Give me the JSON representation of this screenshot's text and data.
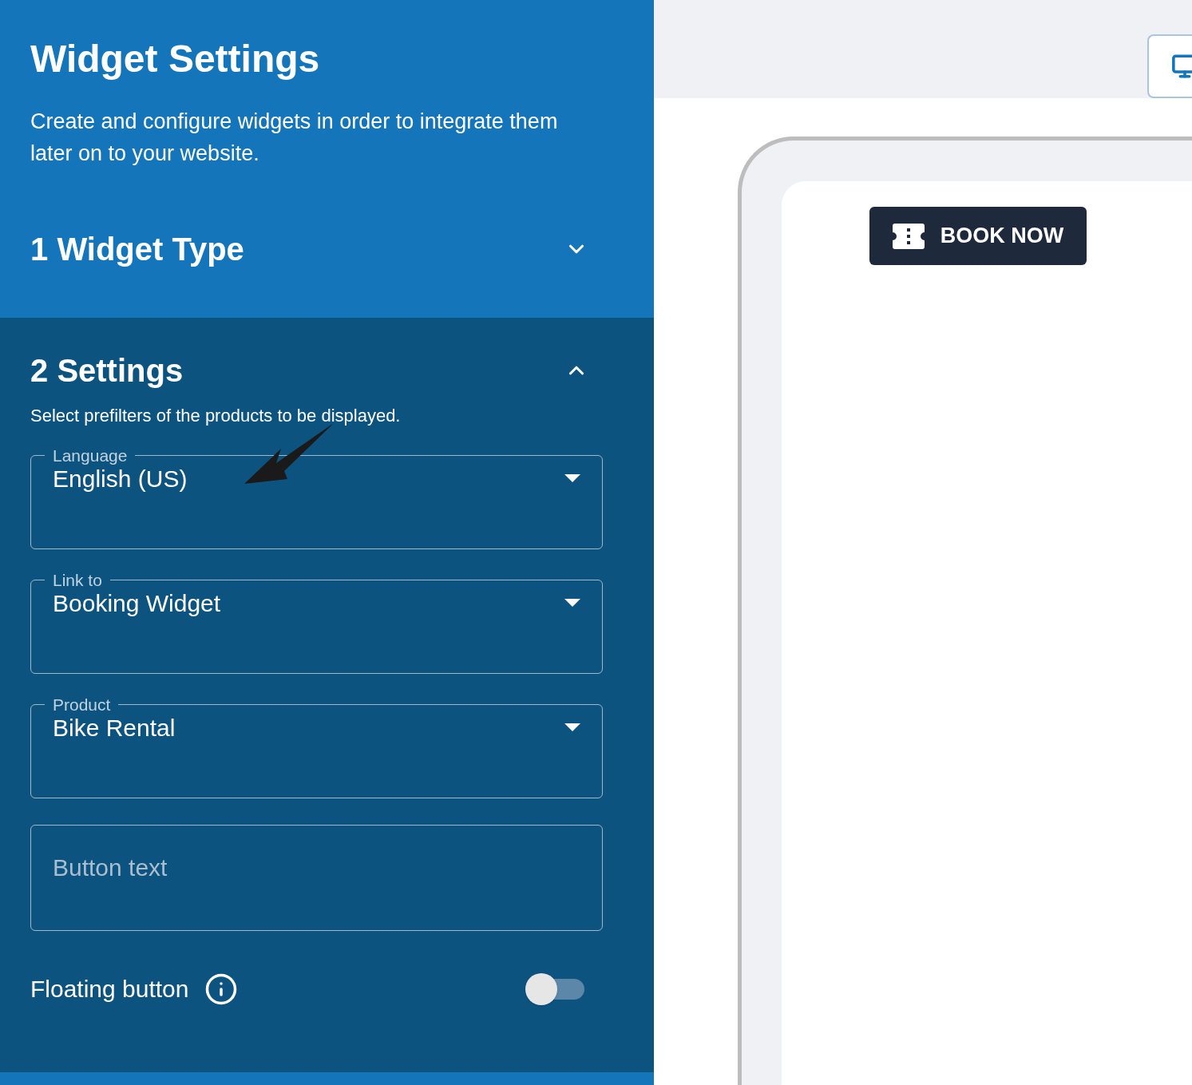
{
  "sidebar": {
    "title": "Widget Settings",
    "description": "Create and configure widgets in order to integrate them later on to your website.",
    "sections": [
      {
        "number": "1",
        "title": "Widget Type",
        "expanded": false
      },
      {
        "number": "2",
        "title": "Settings",
        "expanded": true,
        "description": "Select prefilters of the products to be displayed.",
        "fields": [
          {
            "kind": "select",
            "label": "Language",
            "value": "English (US)"
          },
          {
            "kind": "select",
            "label": "Link to",
            "value": "Booking Widget"
          },
          {
            "kind": "select",
            "label": "Product",
            "value": "Bike Rental"
          },
          {
            "kind": "text",
            "placeholder": "Button text"
          }
        ],
        "toggle": {
          "label": "Floating button",
          "on": false
        }
      }
    ]
  },
  "preview": {
    "button": {
      "label": "BOOK NOW"
    }
  }
}
